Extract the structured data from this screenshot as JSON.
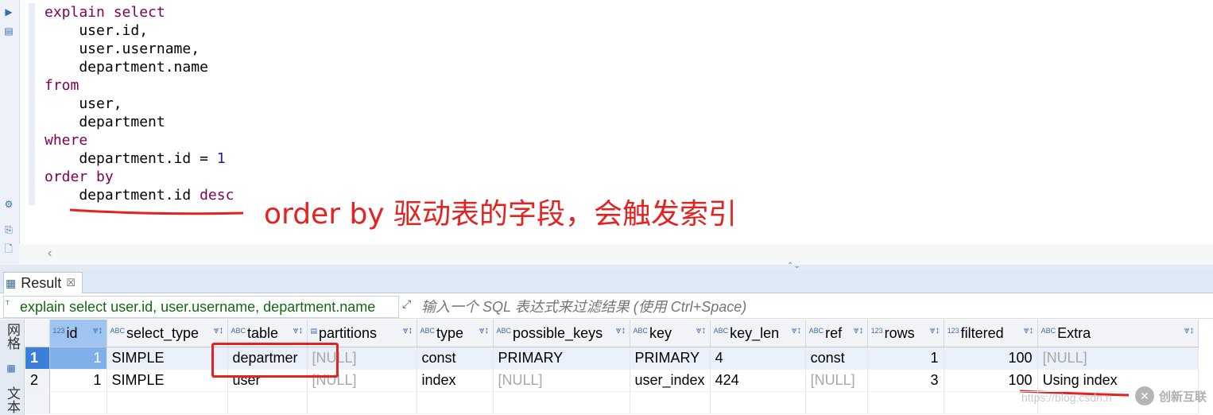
{
  "editor": {
    "lines": [
      [
        {
          "t": "explain select",
          "c": "kw"
        }
      ],
      [
        {
          "t": "    user.id,",
          "c": ""
        }
      ],
      [
        {
          "t": "    user.username,",
          "c": ""
        }
      ],
      [
        {
          "t": "    department.name",
          "c": ""
        }
      ],
      [
        {
          "t": "from",
          "c": "kw"
        }
      ],
      [
        {
          "t": "    user,",
          "c": ""
        }
      ],
      [
        {
          "t": "    department",
          "c": ""
        }
      ],
      [
        {
          "t": "where",
          "c": "kw"
        }
      ],
      [
        {
          "t": "    department.id = ",
          "c": ""
        },
        {
          "t": "1",
          "c": "num"
        }
      ],
      [
        {
          "t": "order by",
          "c": "kw"
        }
      ],
      [
        {
          "t": "    department.id ",
          "c": ""
        },
        {
          "t": "desc",
          "c": "kw"
        }
      ]
    ]
  },
  "annotation": {
    "text": "order by 驱动表的字段，会触发索引",
    "color": "#e5221f"
  },
  "result_tab": {
    "label": "Result",
    "close": "☒"
  },
  "filter": {
    "query_text": "explain select user.id, user.username, department.name",
    "placeholder": "输入一个 SQL 表达式来过滤结果 (使用 Ctrl+Space)"
  },
  "side_tabs": {
    "grid": "网格",
    "text": "文本"
  },
  "grid": {
    "columns": [
      {
        "label": "id",
        "type": "123"
      },
      {
        "label": "select_type",
        "type": "ABC"
      },
      {
        "label": "table",
        "type": "ABC"
      },
      {
        "label": "partitions",
        "type": "doc"
      },
      {
        "label": "type",
        "type": "ABC"
      },
      {
        "label": "possible_keys",
        "type": "ABC"
      },
      {
        "label": "key",
        "type": "ABC"
      },
      {
        "label": "key_len",
        "type": "ABC"
      },
      {
        "label": "ref",
        "type": "ABC"
      },
      {
        "label": "rows",
        "type": "123"
      },
      {
        "label": "filtered",
        "type": "123"
      },
      {
        "label": "Extra",
        "type": "ABC"
      }
    ],
    "rows": [
      {
        "n": "1",
        "cells": [
          "1",
          "SIMPLE",
          "departmer",
          "[NULL]",
          "const",
          "PRIMARY",
          "PRIMARY",
          "4",
          "const",
          "1",
          "100",
          "[NULL]"
        ]
      },
      {
        "n": "2",
        "cells": [
          "1",
          "SIMPLE",
          "user",
          "[NULL]",
          "index",
          "[NULL]",
          "user_index",
          "424",
          "[NULL]",
          "3",
          "100",
          "Using index"
        ]
      }
    ]
  },
  "watermark": {
    "text": "https://blog.csdn.n",
    "logo_text": "创新互联"
  },
  "colors": {
    "keyword": "#7f0055",
    "number": "#1a1aa6",
    "annotation": "#e5221f",
    "selection": "#3b7fd6"
  }
}
